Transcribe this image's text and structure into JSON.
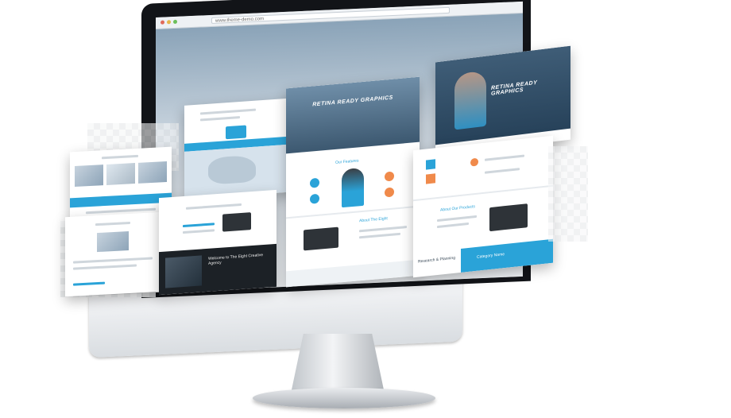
{
  "browser": {
    "url_text": "www.theme-demo.com"
  },
  "screens": {
    "retina_title_center": "RETINA READY GRAPHICS",
    "retina_title_right": "RETINA READY GRAPHICS",
    "our_features": "Our Features",
    "about_the_eight": "About The Eight",
    "about_our_products": "About Our Products",
    "welcome": "Welcome to The Eight Creative Agency",
    "category_name": "Category Name",
    "research_planning": "Research & Planning"
  },
  "colors": {
    "accent": "#2aa3d8",
    "monitor": "#121418",
    "stand": "#c9cdd2"
  }
}
